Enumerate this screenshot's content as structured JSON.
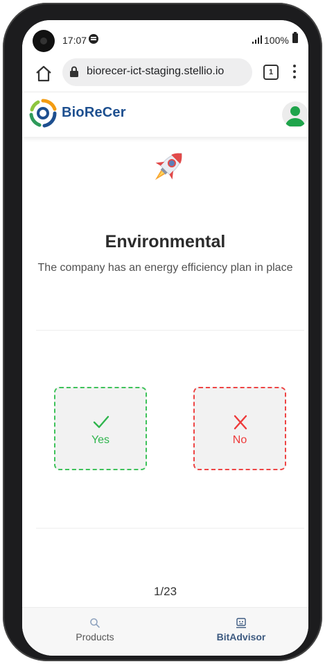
{
  "status_bar": {
    "time": "17:07",
    "battery": "100%"
  },
  "browser": {
    "url": "biorecer-ict-staging.stellio.io",
    "tab_count": "1"
  },
  "header": {
    "brand": "BioReCer"
  },
  "question": {
    "category": "Environmental",
    "text": "The company has an energy efficiency plan in place"
  },
  "answers": {
    "yes_label": "Yes",
    "no_label": "No"
  },
  "pagination": {
    "text": "1/23"
  },
  "bottom_nav": {
    "items": [
      {
        "label": "Products",
        "icon": "search-icon",
        "active": false
      },
      {
        "label": "BitAdvisor",
        "icon": "advisor-icon",
        "active": true
      }
    ]
  },
  "colors": {
    "yes_accent": "#3ec25a",
    "no_accent": "#ee4444",
    "brand_blue": "#1d4f8f",
    "active_nav": "#3d5a80"
  }
}
